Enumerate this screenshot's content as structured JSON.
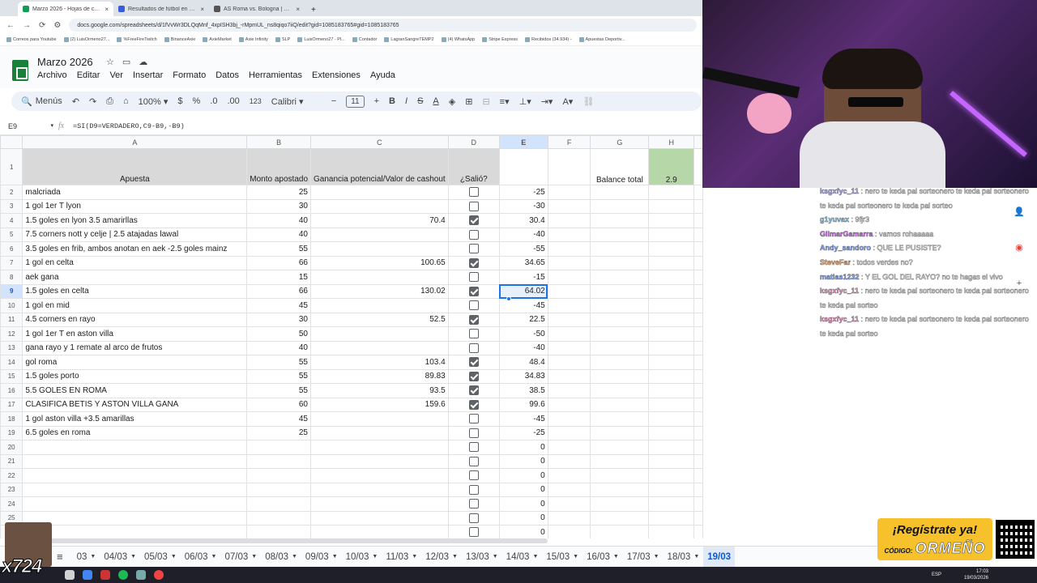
{
  "browser": {
    "tabs": [
      {
        "label": "Marzo 2026 - Hojas de cálculo",
        "color": "#0f9d58"
      },
      {
        "label": "Resultados de fútbol en directo",
        "color": "#3b5bdb"
      },
      {
        "label": "AS Roma vs. Bologna | Evali",
        "color": "#555555"
      }
    ],
    "url": "docs.google.com/spreadsheets/d/1fVvWr3DLQqMnf_4xpISH3bj_-rMpmUL_ns8qiqo7iiQ/edit?gid=1085183765#gid=1085183765",
    "bookmarks": [
      "Correos para Youtube",
      "(2) LuisOrmeno27...",
      "%FreeFireTwitch",
      "BinanceAxie",
      "AxieMarket",
      "Axie Infinity",
      "SLP",
      "LuisOrmeno27 - Pl...",
      "Contador",
      "LagranSangreTEMP2",
      "(4) WhatsApp",
      "Stripe Express",
      "Recibidos (34.934) -",
      "Apuestas Deportiv..."
    ]
  },
  "doc": {
    "title": "Marzo 2026",
    "menus": [
      "Archivo",
      "Editar",
      "Ver",
      "Insertar",
      "Formato",
      "Datos",
      "Herramientas",
      "Extensiones",
      "Ayuda"
    ]
  },
  "toolbar": {
    "search": "Menús",
    "zoom": "100%",
    "currency": "$",
    "percent": "%",
    "dec_less": ".0",
    "dec_more": ".00",
    "numfmt": "123",
    "font": "Calibri",
    "fontsize": "11",
    "bold": "B",
    "italic": "I",
    "strike": "S",
    "textcolor": "A"
  },
  "formula_bar": {
    "cell": "E9",
    "formula": "=SI(D9=VERDADERO,C9-B9,-B9)"
  },
  "columns": [
    "A",
    "B",
    "C",
    "D",
    "E",
    "F",
    "G",
    "H"
  ],
  "header_row": {
    "a": "Apuesta",
    "b": "Monto apostado",
    "c": "Ganancia potencial/Valor de cashout",
    "d": "¿Salió?",
    "g": "Balance total",
    "h": "2.9"
  },
  "rows": [
    {
      "n": "2",
      "a": "malcriada",
      "b": "25",
      "c": "",
      "d": false,
      "e": "-25"
    },
    {
      "n": "3",
      "a": "1 gol 1er T lyon",
      "b": "30",
      "c": "",
      "d": false,
      "e": "-30"
    },
    {
      "n": "4",
      "a": "1.5 goles en lyon 3.5 amarirllas",
      "b": "40",
      "c": "70.4",
      "d": true,
      "e": "30.4"
    },
    {
      "n": "5",
      "a": "7.5 corners nott y celje | 2.5 atajadas lawal",
      "b": "40",
      "c": "",
      "d": false,
      "e": "-40"
    },
    {
      "n": "6",
      "a": "3.5 goles en frib, ambos anotan en aek -2.5 goles mainz",
      "b": "55",
      "c": "",
      "d": false,
      "e": "-55"
    },
    {
      "n": "7",
      "a": "1 gol en celta",
      "b": "66",
      "c": "100.65",
      "d": true,
      "e": "34.65"
    },
    {
      "n": "8",
      "a": "aek gana",
      "b": "15",
      "c": "",
      "d": false,
      "e": "-15"
    },
    {
      "n": "9",
      "a": "1.5 goles en celta",
      "b": "66",
      "c": "130.02",
      "d": true,
      "e": "64.02"
    },
    {
      "n": "10",
      "a": "1 gol en mid",
      "b": "45",
      "c": "",
      "d": false,
      "e": "-45"
    },
    {
      "n": "11",
      "a": "4.5 corners en rayo",
      "b": "30",
      "c": "52.5",
      "d": true,
      "e": "22.5"
    },
    {
      "n": "12",
      "a": "1 gol 1er T en aston villa",
      "b": "50",
      "c": "",
      "d": false,
      "e": "-50"
    },
    {
      "n": "13",
      "a": "gana rayo y 1 remate al arco de frutos",
      "b": "40",
      "c": "",
      "d": false,
      "e": "-40"
    },
    {
      "n": "14",
      "a": "gol roma",
      "b": "55",
      "c": "103.4",
      "d": true,
      "e": "48.4"
    },
    {
      "n": "15",
      "a": "1.5 goles porto",
      "b": "55",
      "c": "89.83",
      "d": true,
      "e": "34.83"
    },
    {
      "n": "16",
      "a": "5.5 GOLES EN ROMA",
      "b": "55",
      "c": "93.5",
      "d": true,
      "e": "38.5"
    },
    {
      "n": "17",
      "a": "CLASIFICA BETIS Y ASTON VILLA GANA",
      "b": "60",
      "c": "159.6",
      "d": true,
      "e": "99.6"
    },
    {
      "n": "18",
      "a": "1 gol aston villa +3.5 amarillas",
      "b": "45",
      "c": "",
      "d": false,
      "e": "-45"
    },
    {
      "n": "19",
      "a": "6.5 goles en roma",
      "b": "25",
      "c": "",
      "d": false,
      "e": "-25"
    },
    {
      "n": "20",
      "a": "",
      "b": "",
      "c": "",
      "d": false,
      "e": "0"
    },
    {
      "n": "21",
      "a": "",
      "b": "",
      "c": "",
      "d": false,
      "e": "0"
    },
    {
      "n": "22",
      "a": "",
      "b": "",
      "c": "",
      "d": false,
      "e": "0"
    },
    {
      "n": "23",
      "a": "",
      "b": "",
      "c": "",
      "d": false,
      "e": "0"
    },
    {
      "n": "24",
      "a": "",
      "b": "",
      "c": "",
      "d": false,
      "e": "0"
    },
    {
      "n": "25",
      "a": "",
      "b": "",
      "c": "",
      "d": false,
      "e": "0"
    },
    {
      "n": "",
      "a": "",
      "b": "",
      "c": "",
      "d": false,
      "e": "0"
    }
  ],
  "sheet_tabs": [
    "03",
    "04/03",
    "05/03",
    "06/03",
    "07/03",
    "08/03",
    "09/03",
    "10/03",
    "11/03",
    "12/03",
    "13/03",
    "14/03",
    "15/03",
    "16/03",
    "17/03",
    "18/03",
    "19/03"
  ],
  "active_sheet": "19/03",
  "chat": [
    {
      "user": "ksgxfyc_11",
      "color": "#b5b5ff",
      "msg": "nero te keda pal sorteonero te keda pal sorteonero te keda pal sorteonero te keda pal sorteo"
    },
    {
      "user": "g1yuvax",
      "color": "#9ad8ff",
      "msg": "9fjr3"
    },
    {
      "user": "GilmarGamarra",
      "color": "#d96bff",
      "msg": "vamos rohaaaaa"
    },
    {
      "user": "Andy_sandoro",
      "color": "#8fb0ff",
      "msg": "QUE LE PUSISTE?"
    },
    {
      "user": "SteveFar",
      "color": "#ffb070",
      "msg": "todos verdes no?"
    },
    {
      "user": "matias1232",
      "color": "#8fb0ff",
      "msg": "Y EL GOL DEL RAYO? no te hagas el vivo"
    },
    {
      "user": "ksgxfyc_11",
      "color": "#ff9bd0",
      "msg": "nero te keda pal sorteonero te keda pal sorteonero te keda pal sorteo"
    },
    {
      "user": "ksgxfyc_11",
      "color": "#ff9bd0",
      "msg": "nero te keda pal sorteonero te keda pal sorteonero te keda pal sorteo"
    }
  ],
  "promo": {
    "line1": "¡Regístrate ya!",
    "code_label": "CÓDIGO:",
    "code": "ORMEÑO"
  },
  "overlay": "x724",
  "taskbar": {
    "time": "17:03",
    "date": "19/03/2026",
    "lang": "ESP"
  }
}
